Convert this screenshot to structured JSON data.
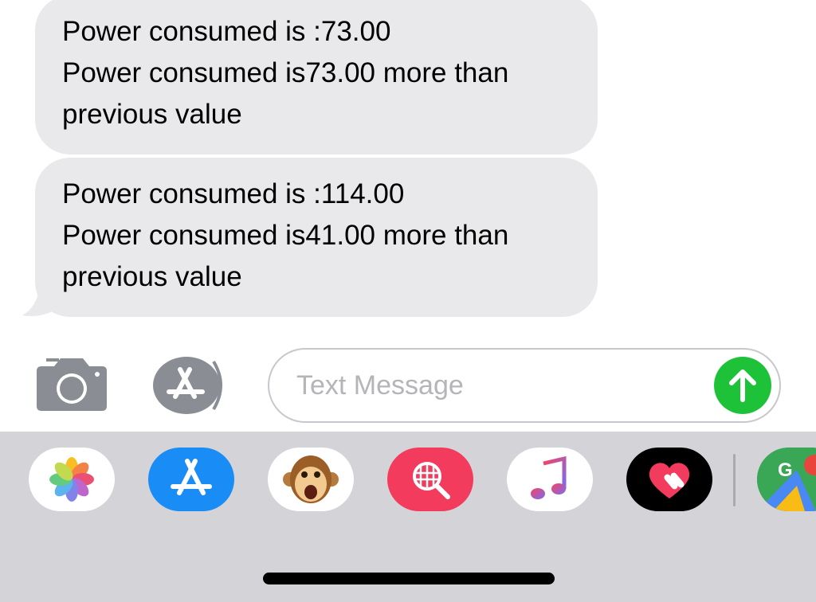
{
  "messages": [
    {
      "line1": "Power consumed is :73.00",
      "line2": "Power consumed is73.00 more than previous value"
    },
    {
      "line1": "Power consumed is :114.00",
      "line2": "Power consumed is41.00 more than previous value"
    }
  ],
  "composer": {
    "placeholder": "Text Message",
    "camera_icon": "camera-icon",
    "apps_icon": "app-store-icon",
    "send_icon": "arrow-up-icon",
    "send_color": "#1ec239"
  },
  "drawer": {
    "apps": [
      {
        "name": "photos",
        "icon": "photos-icon"
      },
      {
        "name": "app-store",
        "icon": "app-store-icon"
      },
      {
        "name": "animoji",
        "icon": "monkey-face-icon"
      },
      {
        "name": "images-search",
        "icon": "globe-search-icon"
      },
      {
        "name": "music",
        "icon": "music-note-icon"
      },
      {
        "name": "digital-touch",
        "icon": "heart-touch-icon"
      },
      {
        "name": "google-maps",
        "icon": "maps-icon",
        "label": "G"
      }
    ]
  },
  "colors": {
    "bubble": "#e9e9eb",
    "drawer": "#d3d3d8",
    "app_store_blue": "#1a8cf5",
    "search_pink": "#f23b5d"
  }
}
